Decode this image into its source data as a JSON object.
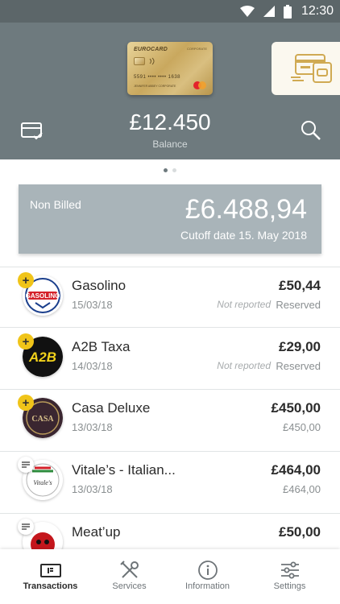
{
  "status_bar": {
    "time": "12:30"
  },
  "header": {
    "card": {
      "brand": "EUROCARD",
      "type": "CORPORATE",
      "number": "5591  ••••  ••••  1638",
      "holder": "JENNIFER ABBEY  CORPORATE"
    },
    "balance_value": "£12.450",
    "balance_label": "Balance"
  },
  "non_billed": {
    "label": "Non Billed",
    "amount": "£6.488,94",
    "cutoff": "Cutoff date 15. May 2018"
  },
  "transactions": [
    {
      "merchant": "Gasolino",
      "date": "15/03/18",
      "amount": "£50,44",
      "status": "Reserved",
      "note": "Not reported",
      "badge": "+"
    },
    {
      "merchant": "A2B Taxa",
      "date": "14/03/18",
      "amount": "£29,00",
      "status": "Reserved",
      "note": "Not reported",
      "badge": "+"
    },
    {
      "merchant": "Casa Deluxe",
      "date": "13/03/18",
      "amount": "£450,00",
      "status": "£450,00",
      "badge": "+"
    },
    {
      "merchant": "Vitale’s - Italian...",
      "date": "13/03/18",
      "amount": "£464,00",
      "status": "£464,00"
    },
    {
      "merchant": "Meat’up",
      "amount": "£50,00"
    }
  ],
  "logos": {
    "gasolino": "GASOLINO",
    "a2b": "A2B",
    "casa": "CASA",
    "vitales": "Vitale's"
  },
  "bottom_nav": [
    {
      "label": "Transactions",
      "icon": "card-list-icon"
    },
    {
      "label": "Services",
      "icon": "tools-icon"
    },
    {
      "label": "Information",
      "icon": "info-icon"
    },
    {
      "label": "Settings",
      "icon": "sliders-icon"
    }
  ],
  "colors": {
    "header": "#6e7a7e",
    "accent": "#f0c419",
    "panel": "#a9b4b9"
  }
}
